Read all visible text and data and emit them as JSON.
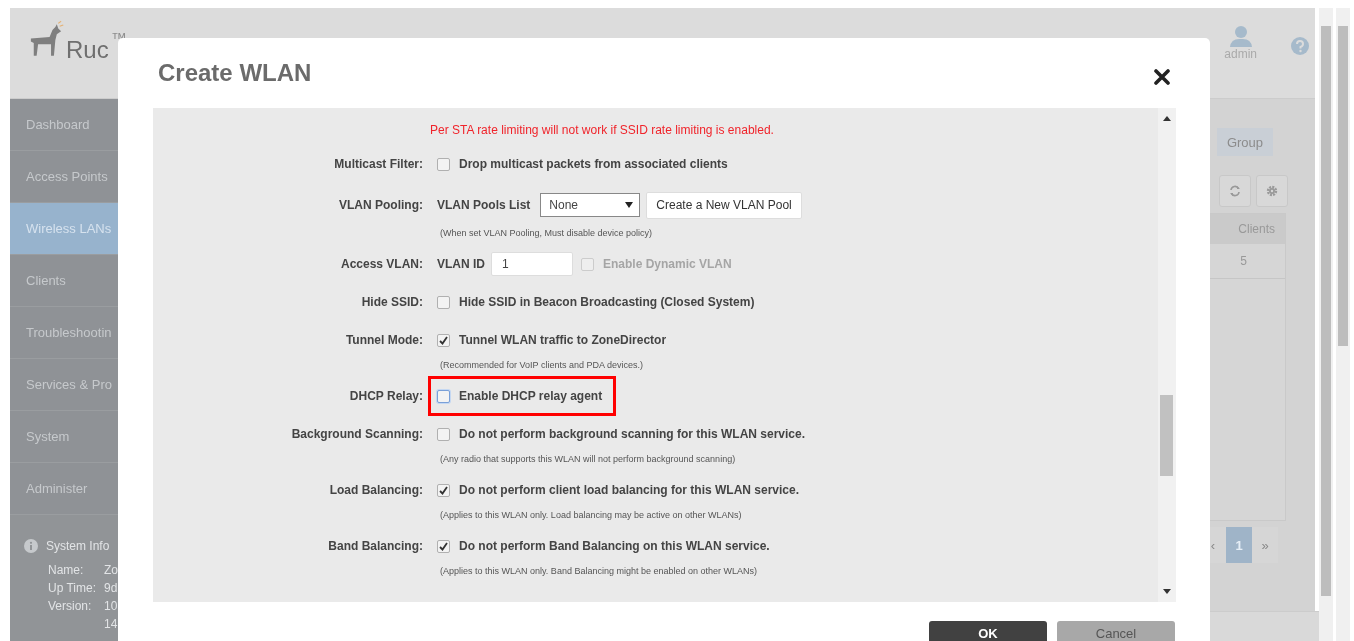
{
  "app": {
    "logo": {
      "text": "Ruc",
      "mark": "™"
    },
    "user": {
      "name": "admin"
    },
    "sidebar": {
      "items": [
        {
          "label": "Dashboard",
          "selected": false
        },
        {
          "label": "Access Points",
          "selected": false
        },
        {
          "label": "Wireless LANs",
          "selected": true
        },
        {
          "label": "Clients",
          "selected": false
        },
        {
          "label": "Troubleshootin",
          "selected": false
        },
        {
          "label": "Services & Pro",
          "selected": false
        },
        {
          "label": "System",
          "selected": false
        },
        {
          "label": "Administer",
          "selected": false
        }
      ]
    },
    "system_info": {
      "title": "System Info",
      "fields": [
        {
          "label": "Name:",
          "value": "Zo"
        },
        {
          "label": "Up Time:",
          "value": "9d"
        },
        {
          "label": "Version:",
          "value": "10"
        },
        {
          "value": "14"
        }
      ]
    },
    "content": {
      "tabs": [
        {
          "label": "Group",
          "selected": false
        }
      ],
      "table": {
        "columns": [
          "Clients"
        ],
        "rows": [
          [
            "5"
          ]
        ]
      },
      "pagination": {
        "prev": "‹",
        "pages": [
          {
            "label": "1",
            "selected": true
          }
        ],
        "next": "»"
      }
    }
  },
  "dialog": {
    "title": "Create WLAN",
    "warning": "Per STA rate limiting will not work if SSID rate limiting is enabled.",
    "rows": [
      {
        "kind": "checkbox",
        "label": "Multicast Filter:",
        "checked": false,
        "text": "Drop multicast packets from associated clients"
      },
      {
        "kind": "vlan_pool",
        "label": "VLAN Pooling:",
        "field_label": "VLAN Pools List",
        "value": "None",
        "button": "Create a New VLAN Pool",
        "note": "(When set VLAN Pooling, Must disable device policy)"
      },
      {
        "kind": "vlan_id",
        "label": "Access VLAN:",
        "field_label": "VLAN ID",
        "value": "1",
        "option": {
          "text": "Enable Dynamic VLAN",
          "checked": false,
          "disabled": true
        }
      },
      {
        "kind": "checkbox",
        "label": "Hide SSID:",
        "checked": false,
        "text": "Hide SSID in Beacon Broadcasting (Closed System)"
      },
      {
        "kind": "checkbox",
        "label": "Tunnel Mode:",
        "checked": true,
        "text": "Tunnel WLAN traffic to ZoneDirector",
        "note": "(Recommended for VoIP clients and PDA devices.)"
      },
      {
        "kind": "checkbox",
        "label": "DHCP Relay:",
        "checked": false,
        "highlighted": true,
        "text": "Enable DHCP relay agent"
      },
      {
        "kind": "checkbox",
        "label": "Background Scanning:",
        "checked": false,
        "text": "Do not perform background scanning for this WLAN service.",
        "note": "(Any radio that supports this WLAN will not perform background scanning)"
      },
      {
        "kind": "checkbox",
        "label": "Load Balancing:",
        "checked": true,
        "text": "Do not perform client load balancing for this WLAN service.",
        "note": "(Applies to this WLAN only. Load balancing may be active on other WLANs)"
      },
      {
        "kind": "checkbox",
        "label": "Band Balancing:",
        "checked": true,
        "text": "Do not perform Band Balancing on this WLAN service.",
        "note": "(Applies to this WLAN only. Band Balancing might be enabled on other WLANs)"
      }
    ],
    "buttons": [
      {
        "label": "OK",
        "kind": "primary"
      },
      {
        "label": "Cancel",
        "kind": "secondary"
      }
    ]
  }
}
